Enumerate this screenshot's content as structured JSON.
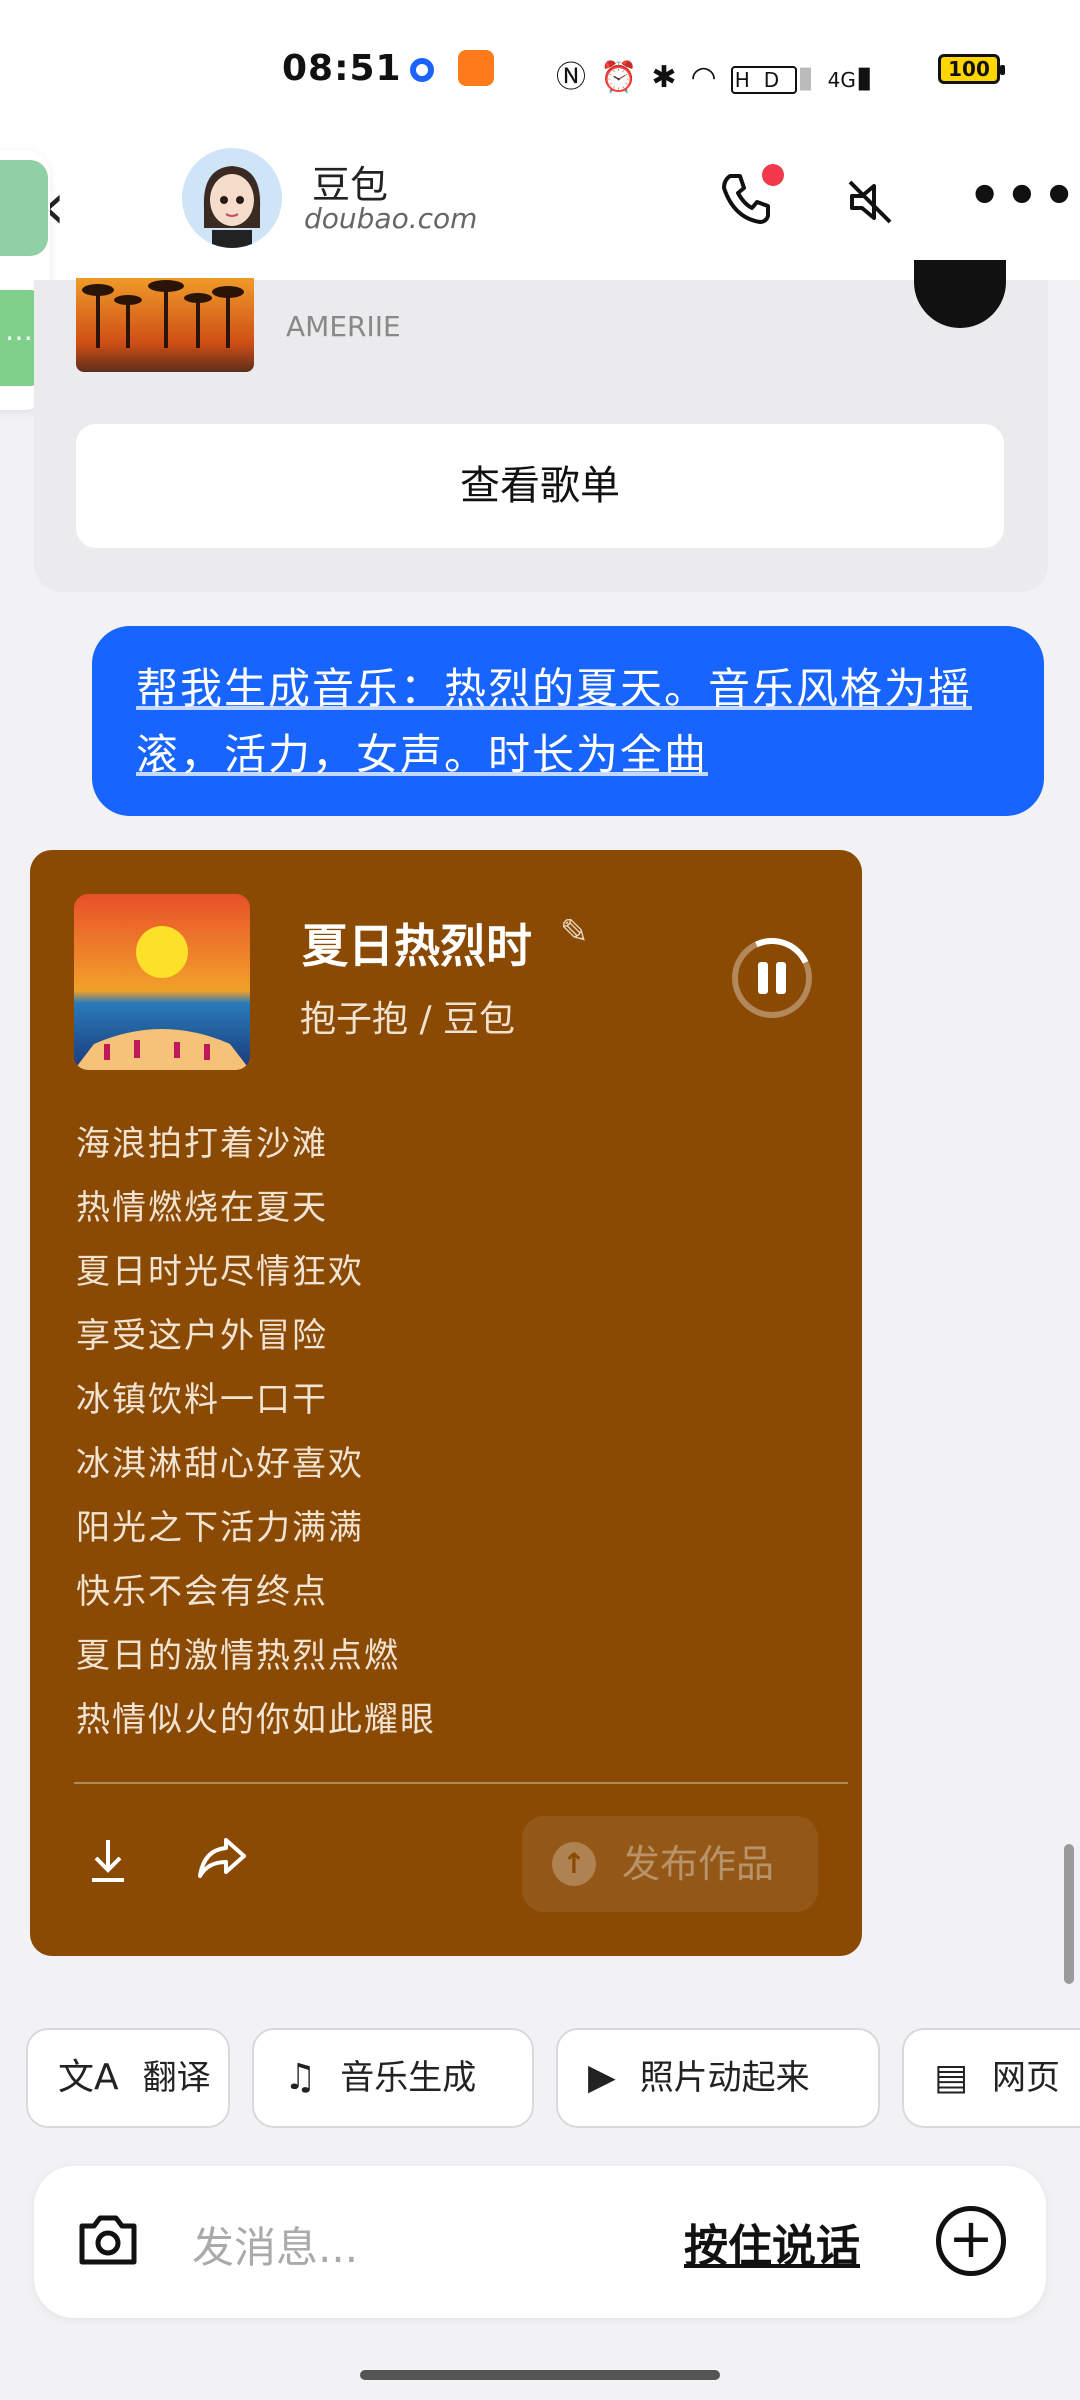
{
  "status_bar": {
    "time": "08:51",
    "battery": "100",
    "network": "4G",
    "icons": [
      "nfc-icon",
      "alarm-icon",
      "bluetooth-icon",
      "wifi-icon",
      "hd-icon",
      "signal-icon"
    ]
  },
  "header": {
    "name": "豆包",
    "domain": "doubao.com"
  },
  "playlist_card": {
    "artist": "AMERIIE",
    "view_button": "查看歌单"
  },
  "user_message": {
    "text": "帮我生成音乐：热烈的夏天。音乐风格为摇滚，活力，女声。时长为全曲"
  },
  "music_card": {
    "title": "夏日热烈时",
    "creator": "抱子抱 / 豆包",
    "lyrics": [
      "海浪拍打着沙滩",
      "热情燃烧在夏天",
      "夏日时光尽情狂欢",
      "享受这户外冒险",
      "冰镇饮料一口干",
      "冰淇淋甜心好喜欢",
      "阳光之下活力满满",
      "快乐不会有终点",
      "夏日的激情热烈点燃",
      "热情似火的你如此耀眼"
    ],
    "publish_label": "发布作品"
  },
  "chips": [
    "翻译",
    "音乐生成",
    "照片动起来",
    "网页"
  ],
  "input_bar": {
    "placeholder": "发消息...",
    "hold_to_talk": "按住说话"
  },
  "colors": {
    "accent_blue": "#1764ff",
    "music_card_bg": "#8a4a04",
    "badge_red": "#f2384b"
  }
}
